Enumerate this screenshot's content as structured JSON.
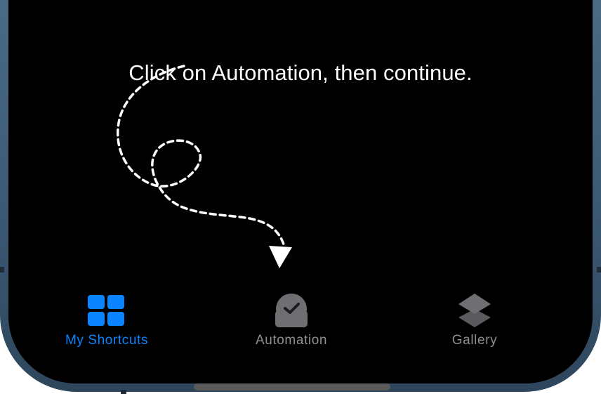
{
  "instruction": {
    "text": "Click on Automation, then continue."
  },
  "tab_bar": {
    "tabs": [
      {
        "id": "my-shortcuts",
        "label": "My Shortcuts",
        "icon": "grid-icon",
        "selected": true
      },
      {
        "id": "automation",
        "label": "Automation",
        "icon": "clock-icon",
        "selected": false
      },
      {
        "id": "gallery",
        "label": "Gallery",
        "icon": "stack-icon",
        "selected": false
      }
    ]
  },
  "colors": {
    "accent": "#0a84ff",
    "inactive": "#8e8e93",
    "inactive_icon": "#6e6e73",
    "screen": "#000000",
    "frame": "#3f5c77"
  },
  "guide": {
    "arrow_style": "dashed-loop",
    "points_to": "Automation"
  }
}
